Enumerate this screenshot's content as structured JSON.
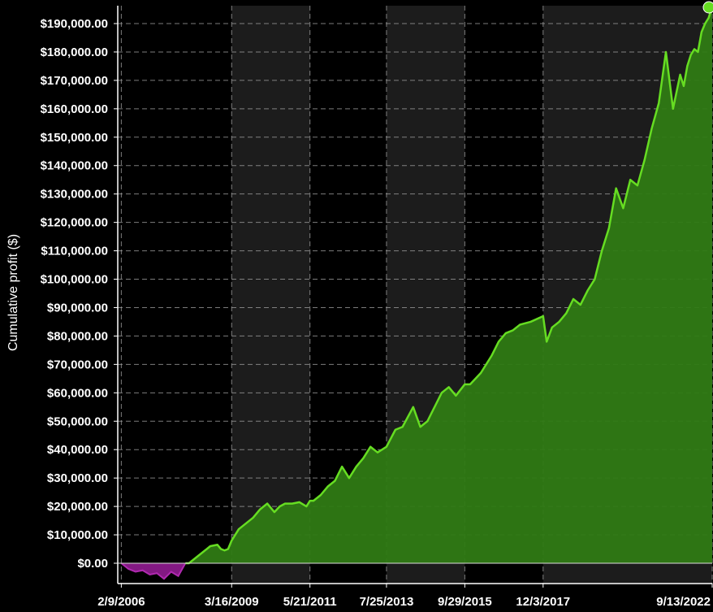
{
  "chart_data": {
    "type": "area",
    "ylabel": "Cumulative profit ($)",
    "ylim": [
      -7000,
      196000
    ],
    "y_ticks": [
      "$0.00",
      "$10,000.00",
      "$20,000.00",
      "$30,000.00",
      "$40,000.00",
      "$50,000.00",
      "$60,000.00",
      "$70,000.00",
      "$80,000.00",
      "$90,000.00",
      "$100,000.00",
      "$110,000.00",
      "$120,000.00",
      "$130,000.00",
      "$140,000.00",
      "$150,000.00",
      "$160,000.00",
      "$170,000.00",
      "$180,000.00",
      "$190,000.00"
    ],
    "y_tick_values": [
      0,
      10000,
      20000,
      30000,
      40000,
      50000,
      60000,
      70000,
      80000,
      90000,
      100000,
      110000,
      120000,
      130000,
      140000,
      150000,
      160000,
      170000,
      180000,
      190000
    ],
    "x_ticks": [
      "2/9/2006",
      "3/16/2009",
      "5/21/2011",
      "7/25/2013",
      "9/29/2015",
      "12/3/2017",
      "9/13/2022"
    ],
    "x_tick_values": [
      2006.1,
      2009.2,
      2011.4,
      2013.55,
      2015.75,
      2017.95,
      2022.7
    ],
    "xlim": [
      2006.0,
      2022.7
    ],
    "grid": true,
    "colors": {
      "positive_line": "#66dd22",
      "positive_fill": "#2f7a14",
      "negative_fill": "#8a1a8a",
      "band": "#1c1c1c",
      "background": "#000000"
    },
    "series": [
      {
        "x": [
          2006.1,
          2006.3,
          2006.5,
          2006.7,
          2006.9,
          2007.1,
          2007.3,
          2007.5,
          2007.7,
          2007.9,
          2008.0,
          2008.2,
          2008.4,
          2008.6,
          2008.8,
          2008.9,
          2009.0,
          2009.1,
          2009.2,
          2009.4,
          2009.6,
          2009.8,
          2010.0,
          2010.2,
          2010.4,
          2010.55,
          2010.7,
          2010.9,
          2011.1,
          2011.3,
          2011.4,
          2011.5,
          2011.7,
          2011.9,
          2012.1,
          2012.3,
          2012.5,
          2012.7,
          2012.9,
          2013.1,
          2013.3,
          2013.55,
          2013.8,
          2014.0,
          2014.3,
          2014.5,
          2014.7,
          2014.9,
          2015.1,
          2015.3,
          2015.5,
          2015.75,
          2015.9,
          2016.2,
          2016.5,
          2016.7,
          2016.9,
          2017.1,
          2017.3,
          2017.6,
          2017.95,
          2018.05,
          2018.2,
          2018.4,
          2018.6,
          2018.8,
          2019.0,
          2019.2,
          2019.4,
          2019.6,
          2019.8,
          2020.0,
          2020.2,
          2020.4,
          2020.6,
          2020.8,
          2021.0,
          2021.2,
          2021.4,
          2021.6,
          2021.8,
          2021.9,
          2022.0,
          2022.1,
          2022.2,
          2022.3,
          2022.4,
          2022.5,
          2022.6,
          2022.7
        ],
        "y": [
          0,
          -2000,
          -3000,
          -2500,
          -4000,
          -3500,
          -5500,
          -3000,
          -4500,
          0,
          0,
          2000,
          4000,
          6000,
          6500,
          5000,
          4500,
          5000,
          8000,
          12000,
          14000,
          16000,
          19000,
          21000,
          18000,
          20000,
          21000,
          21000,
          21500,
          20000,
          22000,
          22000,
          24000,
          27000,
          29000,
          34000,
          30000,
          34000,
          37000,
          41000,
          39000,
          41000,
          47000,
          48000,
          55000,
          48000,
          50000,
          55000,
          60000,
          62000,
          59000,
          63000,
          63000,
          67000,
          73000,
          78000,
          81000,
          82000,
          84000,
          85000,
          87000,
          78000,
          83000,
          85000,
          88000,
          93000,
          91000,
          96000,
          100000,
          110000,
          118000,
          132000,
          125000,
          135000,
          133000,
          142000,
          153000,
          162000,
          180000,
          160000,
          172000,
          168000,
          175000,
          179000,
          181000,
          180000,
          187000,
          190000,
          192000,
          196000
        ]
      }
    ]
  }
}
